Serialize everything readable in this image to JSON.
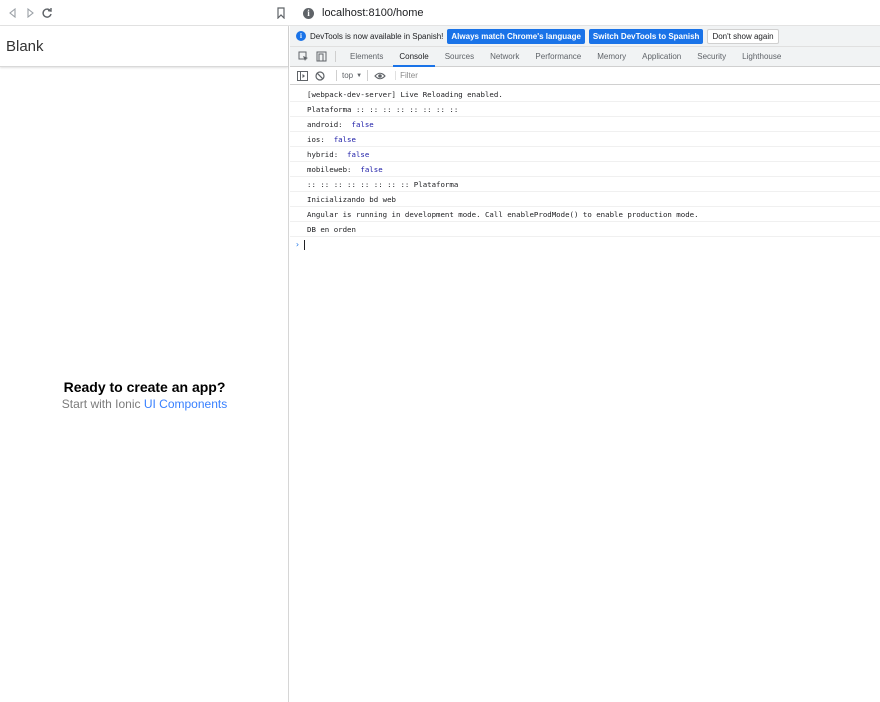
{
  "browser": {
    "url": "localhost:8100/home",
    "info_icon": "i"
  },
  "app": {
    "title": "Blank",
    "ready_title": "Ready to create an app?",
    "ready_sub_prefix": "Start with Ionic ",
    "ready_sub_link": "UI Components",
    "link_color": "#3880ff"
  },
  "devtools": {
    "infobar": {
      "icon": "i",
      "message": "DevTools is now available in Spanish!",
      "btn_match": "Always match Chrome's language",
      "btn_switch": "Switch DevTools to Spanish",
      "btn_dismiss": "Don't show again"
    },
    "tabs": [
      "Elements",
      "Console",
      "Sources",
      "Network",
      "Performance",
      "Memory",
      "Application",
      "Security",
      "Lighthouse"
    ],
    "active_tab": "Console",
    "toolbar": {
      "context": "top",
      "context_arrow": "▼",
      "filter_placeholder": "Filter"
    },
    "logs": [
      {
        "text": "[webpack-dev-server] Live Reloading enabled.",
        "value": ""
      },
      {
        "text": "Plataforma :: :: :: :: :: :: :: ::",
        "value": ""
      },
      {
        "text": "android:  ",
        "value": "false"
      },
      {
        "text": "ios:  ",
        "value": "false"
      },
      {
        "text": "hybrid:  ",
        "value": "false"
      },
      {
        "text": "mobileweb:  ",
        "value": "false"
      },
      {
        "text": ":: :: :: :: :: :: :: :: Plataforma",
        "value": ""
      },
      {
        "text": "Inicializando bd web",
        "value": ""
      },
      {
        "text": "Angular is running in development mode. Call enableProdMode() to enable production mode.",
        "value": ""
      },
      {
        "text": "DB en orden",
        "value": ""
      }
    ],
    "prompt_symbol": "›",
    "accent": "#1a73e8"
  }
}
